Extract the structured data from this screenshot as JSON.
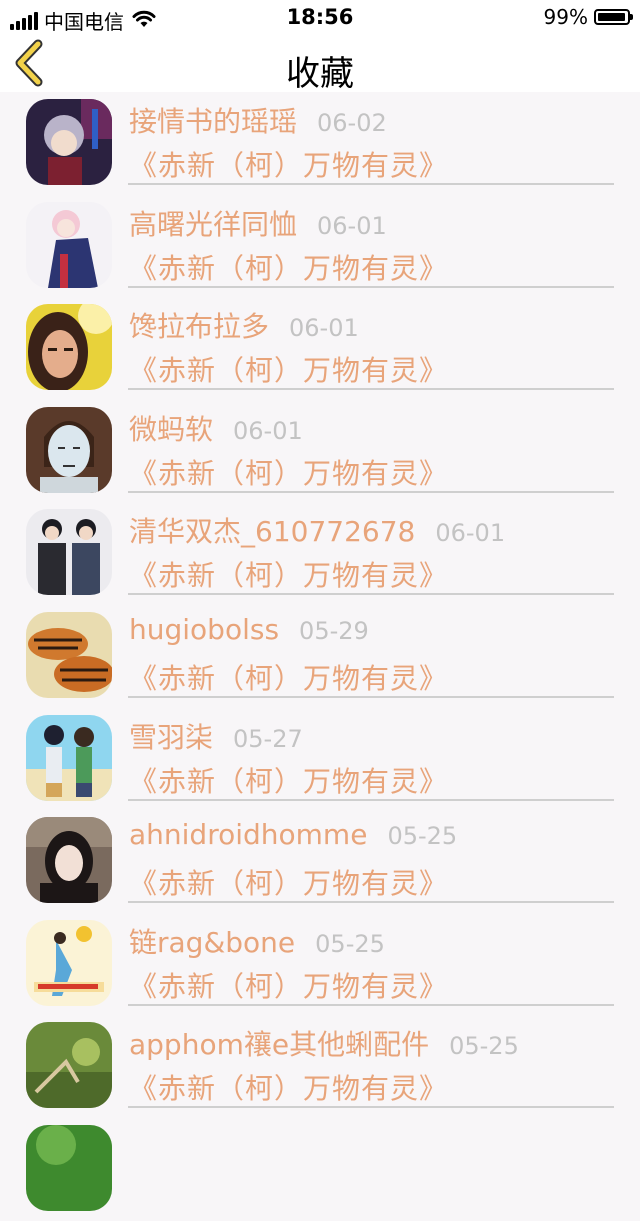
{
  "status_bar": {
    "carrier": "中国电信",
    "time": "18:56",
    "battery_percent": "99%",
    "battery_level": 0.99
  },
  "nav": {
    "title": "收藏",
    "back_icon": "chevron-left-icon"
  },
  "colors": {
    "accent": "#e8a47a",
    "date": "#c3c3c3",
    "divider": "#cfcfcf",
    "background": "#f8f6f8"
  },
  "favorites": [
    {
      "user": "接情书的瑶瑶",
      "date": "06-02",
      "work": "《赤新（柯）万物有灵》",
      "avatar": "anime-girl-avatar"
    },
    {
      "user": "高曙光徉同恤",
      "date": "06-01",
      "work": "《赤新（柯）万物有灵》",
      "avatar": "anime-boy-avatar"
    },
    {
      "user": "馋拉布拉多",
      "date": "06-01",
      "work": "《赤新（柯）万物有灵》",
      "avatar": "portrait-avatar"
    },
    {
      "user": "微蚂软",
      "date": "06-01",
      "work": "《赤新（柯）万物有灵》",
      "avatar": "cartoon-face-avatar"
    },
    {
      "user": "清华双杰_610772678",
      "date": "06-01",
      "work": "《赤新（柯）万物有灵》",
      "avatar": "two-men-avatar"
    },
    {
      "user": "hugiobolss",
      "date": "05-29",
      "work": "《赤新（柯）万物有灵》",
      "avatar": "tigers-avatar"
    },
    {
      "user": "雪羽柒",
      "date": "05-27",
      "work": "《赤新（柯）万物有灵》",
      "avatar": "anime-couple-avatar"
    },
    {
      "user": "ahnidroidhomme",
      "date": "05-25",
      "work": "《赤新（柯）万物有灵》",
      "avatar": "girl-photo-avatar"
    },
    {
      "user": "链rag&bone",
      "date": "05-25",
      "work": "《赤新（柯）万物有灵》",
      "avatar": "illustration-avatar"
    },
    {
      "user": "apphom禳e其他蜊配件",
      "date": "05-25",
      "work": "《赤新（柯）万物有灵》",
      "avatar": "nature-avatar"
    },
    {
      "user": "",
      "date": "",
      "work": "",
      "avatar": "green-avatar"
    }
  ]
}
